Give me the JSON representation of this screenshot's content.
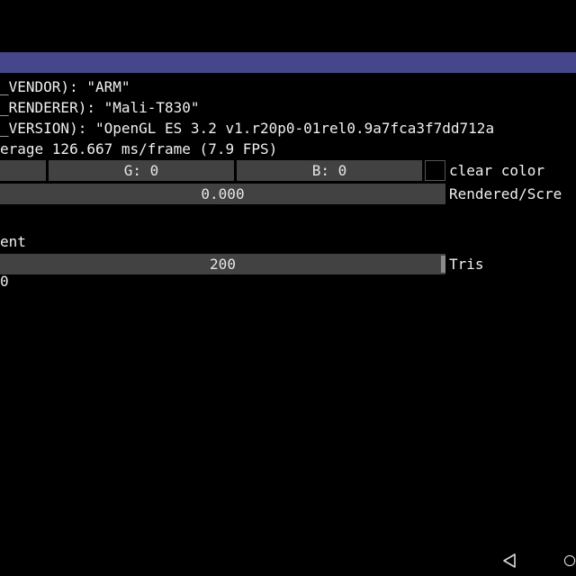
{
  "window": {
    "title": ""
  },
  "info": {
    "vendor_line": "_VENDOR): \"ARM\"",
    "renderer_line": "_RENDERER): \"Mali-T830\"",
    "version_line": "_VERSION): \"OpenGL ES 3.2 v1.r20p0-01rel0.9a7fca3f7dd712a",
    "fps_line": "erage 126.667 ms/frame (7.9 FPS)"
  },
  "clear_color": {
    "g_text": "G:  0",
    "b_text": "B:  0",
    "label": "clear color",
    "swatch_color": "#000000"
  },
  "rendered": {
    "value": "0.000",
    "label": "Rendered/Scre"
  },
  "section": {
    "label": "ent"
  },
  "tris": {
    "value": "200",
    "label": "Tris"
  },
  "partial": {
    "text": "0"
  },
  "navbar": {
    "back_icon": "back-triangle-icon",
    "home_icon": "home-circle-icon"
  },
  "colors": {
    "titlebar": "#45478a",
    "widget_bg": "#424242"
  }
}
